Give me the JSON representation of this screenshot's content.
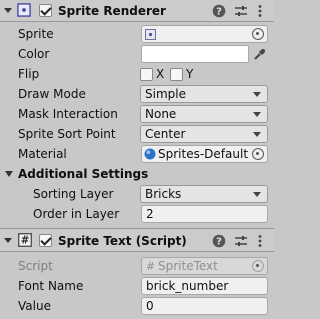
{
  "sprite_renderer": {
    "title": "Sprite Renderer",
    "enabled": true,
    "fields": {
      "sprite_label": "Sprite",
      "color_label": "Color",
      "flip_label": "Flip",
      "flip_x": "X",
      "flip_y": "Y",
      "draw_mode_label": "Draw Mode",
      "draw_mode_value": "Simple",
      "mask_interaction_label": "Mask Interaction",
      "mask_interaction_value": "None",
      "sprite_sort_point_label": "Sprite Sort Point",
      "sprite_sort_point_value": "Center",
      "material_label": "Material",
      "material_value": "Sprites-Default"
    },
    "additional_settings": {
      "title": "Additional Settings",
      "sorting_layer_label": "Sorting Layer",
      "sorting_layer_value": "Bricks",
      "order_in_layer_label": "Order in Layer",
      "order_in_layer_value": "2"
    }
  },
  "sprite_text": {
    "title": "Sprite Text (Script)",
    "enabled": true,
    "script_label": "Script",
    "script_value": "SpriteText",
    "font_name_label": "Font Name",
    "font_name_value": "brick_number",
    "value_label": "Value",
    "value_value": "0"
  },
  "colors": {
    "background": "#c8c8c8",
    "color_field": "#ffffff"
  }
}
